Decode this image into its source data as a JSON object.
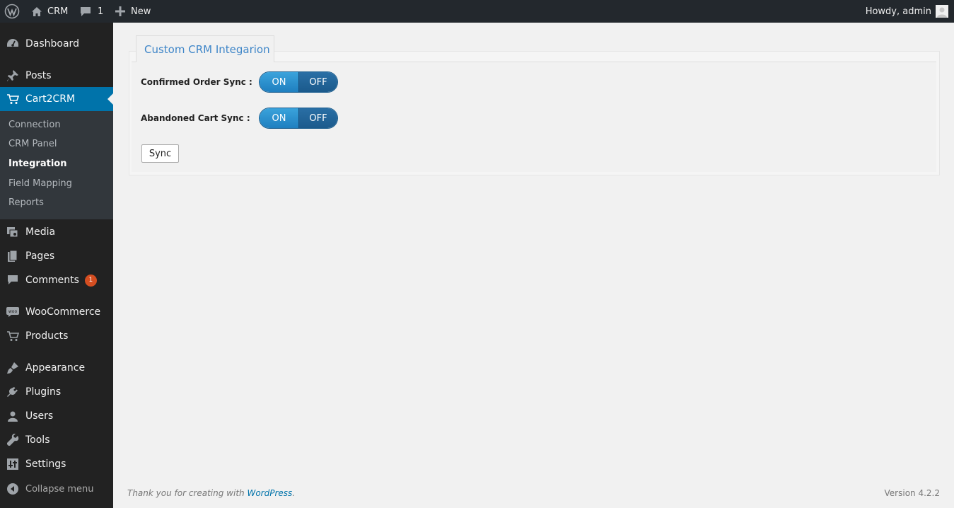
{
  "admin_bar": {
    "site_name": "CRM",
    "comments_count": "1",
    "new_label": "New",
    "howdy": "Howdy, admin"
  },
  "sidebar": {
    "items": [
      {
        "label": "Dashboard",
        "icon": "dashboard-icon"
      },
      {
        "label": "Posts",
        "icon": "pin-icon"
      },
      {
        "label": "Cart2CRM",
        "icon": "cart-icon"
      },
      {
        "label": "Media",
        "icon": "media-icon"
      },
      {
        "label": "Pages",
        "icon": "pages-icon"
      },
      {
        "label": "Comments",
        "icon": "comment-icon",
        "badge": "1"
      },
      {
        "label": "WooCommerce",
        "icon": "woo-icon"
      },
      {
        "label": "Products",
        "icon": "products-icon"
      },
      {
        "label": "Appearance",
        "icon": "brush-icon"
      },
      {
        "label": "Plugins",
        "icon": "plugin-icon"
      },
      {
        "label": "Users",
        "icon": "user-icon"
      },
      {
        "label": "Tools",
        "icon": "wrench-icon"
      },
      {
        "label": "Settings",
        "icon": "settings-icon"
      }
    ],
    "submenu": [
      "Connection",
      "CRM Panel",
      "Integration",
      "Field Mapping",
      "Reports"
    ],
    "current_submenu": "Integration",
    "collapse_label": "Collapse menu"
  },
  "main": {
    "tab_label": "Custom CRM Integarion",
    "rows": [
      {
        "label": "Confirmed Order Sync :",
        "on": "ON",
        "off": "OFF"
      },
      {
        "label": "Abandoned Cart Sync :",
        "on": "ON",
        "off": "OFF"
      }
    ],
    "sync_button": "Sync"
  },
  "footer": {
    "thanks_prefix": "Thank you for creating with ",
    "thanks_link": "WordPress",
    "thanks_suffix": ".",
    "version": "Version 4.2.2"
  },
  "colors": {
    "admin_bar_bg": "#23282d",
    "sidebar_bg": "#222222",
    "submenu_bg": "#32373c",
    "accent": "#0073aa",
    "badge": "#d54e21",
    "tab_text": "#3f86c8"
  }
}
